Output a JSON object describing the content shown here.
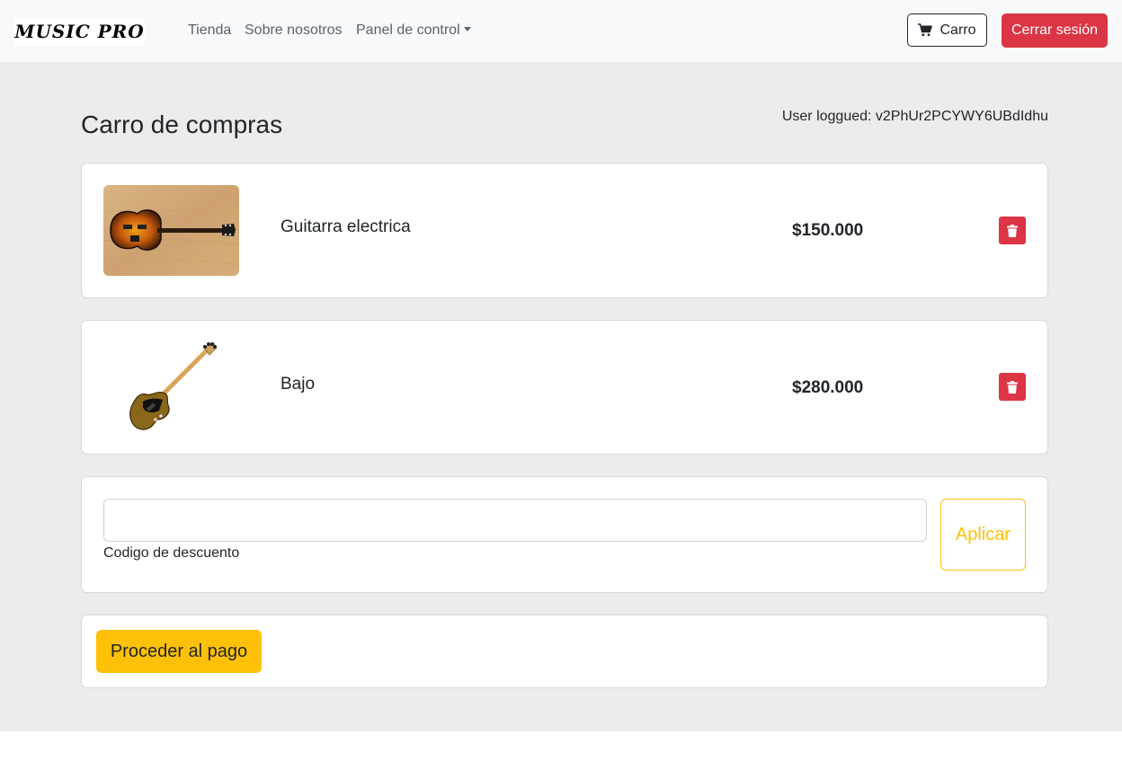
{
  "navbar": {
    "logo_text": "MUSIC PRO",
    "links": [
      "Tienda",
      "Sobre nosotros",
      "Panel de control"
    ],
    "cart_label": "Carro",
    "logout_label": "Cerrar sesión"
  },
  "page": {
    "title": "Carro de compras",
    "user_info": "User loggued: v2PhUr2PCYWY6UBdIdhu"
  },
  "cart": {
    "items": [
      {
        "name": "Guitarra electrica",
        "price": "$150.000",
        "image": "electric-guitar-image"
      },
      {
        "name": "Bajo",
        "price": "$280.000",
        "image": "bass-guitar-image"
      }
    ]
  },
  "discount": {
    "value": "",
    "label": "Codigo de descuento",
    "apply_label": "Aplicar"
  },
  "checkout": {
    "pay_label": "Proceder al pago"
  },
  "colors": {
    "danger": "#dc3545",
    "warning": "#ffc107",
    "navbar_bg": "#f8f9fa",
    "page_bg": "#ececec"
  }
}
